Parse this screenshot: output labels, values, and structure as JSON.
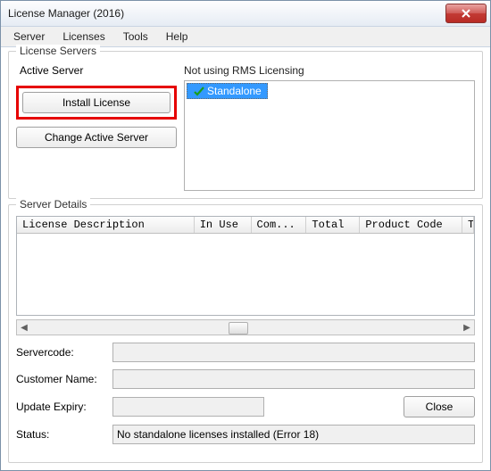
{
  "window": {
    "title": "License Manager (2016)",
    "close": "X"
  },
  "menu": {
    "server": "Server",
    "licenses": "Licenses",
    "tools": "Tools",
    "help": "Help"
  },
  "license_servers": {
    "legend": "License Servers",
    "active_server_label": "Active Server",
    "install_license": "Install License",
    "change_active": "Change Active Server",
    "status": "Not using RMS Licensing",
    "tree": {
      "standalone": "Standalone"
    }
  },
  "server_details": {
    "legend": "Server Details",
    "columns": {
      "desc": "License Description",
      "in_use": "In Use",
      "com": "Com...",
      "total": "Total",
      "product_code": "Product Code",
      "time_rem": "Time rem"
    }
  },
  "fields": {
    "servercode_label": "Servercode:",
    "servercode_value": "",
    "customer_label": "Customer Name:",
    "customer_value": "",
    "expiry_label": "Update Expiry:",
    "expiry_value": "",
    "close_btn": "Close",
    "status_label": "Status:",
    "status_value": "No standalone licenses installed (Error 18)"
  }
}
